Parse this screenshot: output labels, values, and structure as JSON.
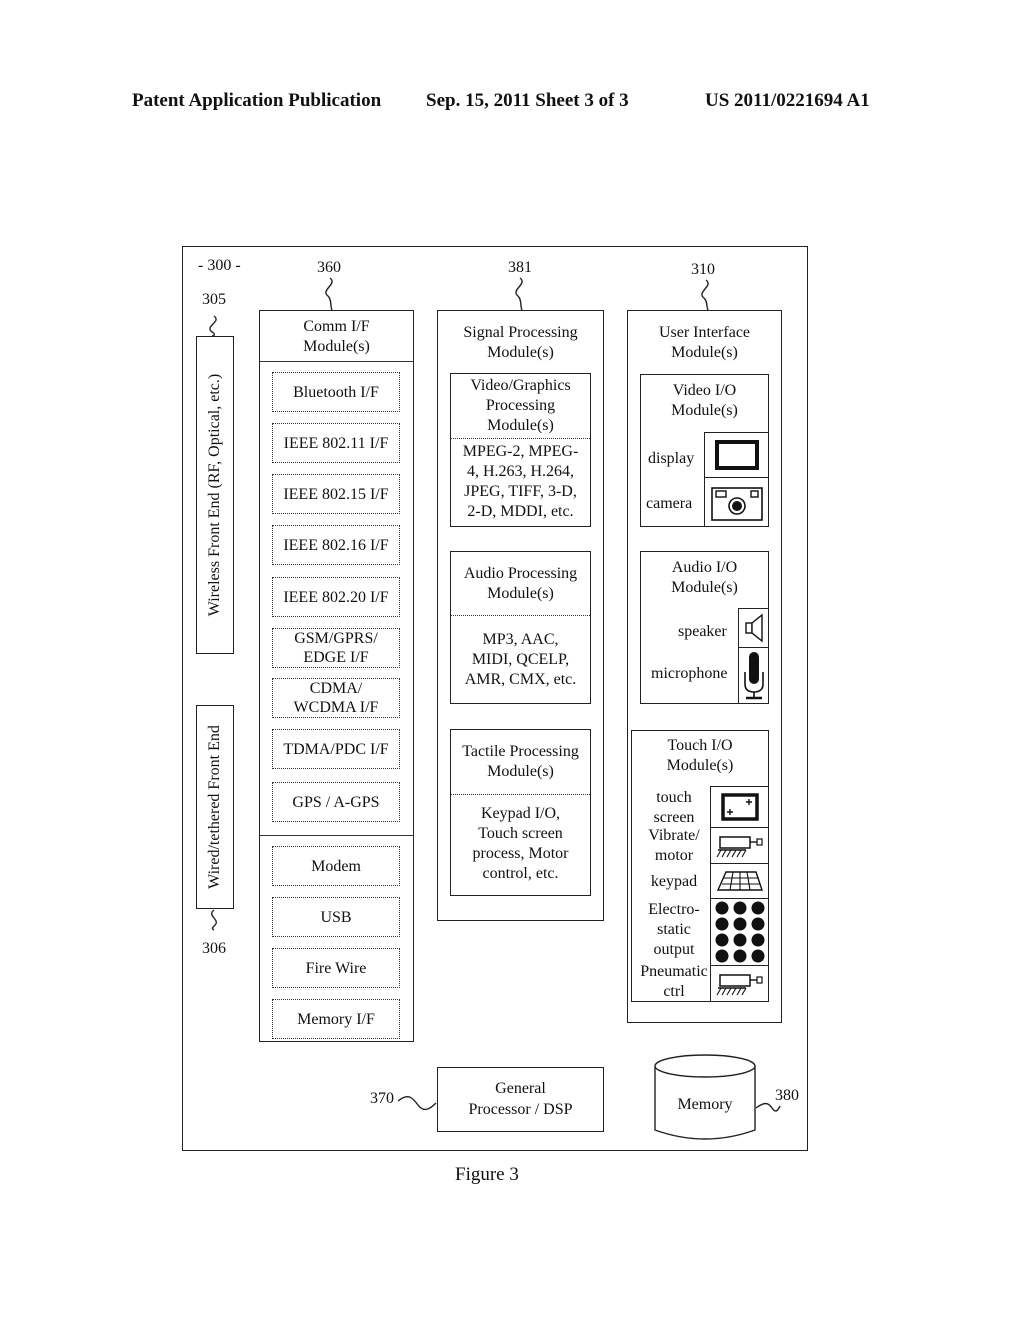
{
  "header": {
    "publication": "Patent Application Publication",
    "date_sheet": "Sep. 15, 2011   Sheet 3 of 3",
    "number": "US 2011/0221694 A1"
  },
  "figure": {
    "caption": "Figure 3",
    "system_ref": "- 300 -",
    "wireless_front_end": {
      "ref": "305",
      "label": "Wireless Front End (RF, Optical, etc.)"
    },
    "wired_front_end": {
      "ref": "306",
      "label": "Wired/tethered Front End"
    },
    "comm_module": {
      "ref": "360",
      "title": [
        "Comm I/F",
        "Module(s)"
      ],
      "wireless_items": [
        "Bluetooth I/F",
        "IEEE 802.11 I/F",
        "IEEE 802.15 I/F",
        "IEEE 802.16 I/F",
        "IEEE 802.20 I/F",
        "GSM/GPRS/ EDGE I/F",
        "CDMA/ WCDMA I/F",
        "TDMA/PDC I/F",
        "GPS / A-GPS"
      ],
      "wired_items": [
        "Modem",
        "USB",
        "Fire Wire",
        "Memory I/F"
      ]
    },
    "signal_module": {
      "ref": "381",
      "title": [
        "Signal Processing",
        "Module(s)"
      ],
      "video": {
        "title": [
          "Video/Graphics",
          "Processing",
          "Module(s)"
        ],
        "formats": [
          "MPEG-2, MPEG-",
          "4, H.263, H.264,",
          "JPEG, TIFF, 3-D,",
          "2-D, MDDI, etc."
        ]
      },
      "audio": {
        "title": [
          "Audio Processing",
          "Module(s)"
        ],
        "formats": [
          "MP3, AAC,",
          "MIDI, QCELP,",
          "AMR, CMX, etc."
        ]
      },
      "tactile": {
        "title": [
          "Tactile Processing",
          "Module(s)"
        ],
        "formats": [
          "Keypad I/O,",
          "Touch screen",
          "process, Motor",
          "control, etc."
        ]
      }
    },
    "ui_module": {
      "ref": "310",
      "title": [
        "User Interface",
        "Module(s)"
      ],
      "video_io": {
        "title": [
          "Video I/O",
          "Module(s)"
        ],
        "items": [
          {
            "label": "display",
            "icon": "display-icon"
          },
          {
            "label": "camera",
            "icon": "camera-icon"
          }
        ]
      },
      "audio_io": {
        "title": [
          "Audio I/O",
          "Module(s)"
        ],
        "items": [
          {
            "label": "speaker",
            "icon": "speaker-icon"
          },
          {
            "label": "microphone",
            "icon": "microphone-icon"
          }
        ]
      },
      "touch_io": {
        "title": [
          "Touch I/O",
          "Module(s)"
        ],
        "items": [
          {
            "label": "touch screen",
            "lines": [
              "touch",
              "screen"
            ],
            "icon": "touch-screen-icon"
          },
          {
            "label": "Vibrate/ motor",
            "lines": [
              "Vibrate/",
              "motor"
            ],
            "icon": "vibrate-motor-icon"
          },
          {
            "label": "keypad",
            "lines": [
              "keypad"
            ],
            "icon": "keypad-icon"
          },
          {
            "label": "Electro- static output",
            "lines": [
              "Electro-",
              "static",
              "output"
            ],
            "icon": "electrostatic-output-icon"
          },
          {
            "label": "Pneumatic ctrl",
            "lines": [
              "Pneumatic",
              "ctrl"
            ],
            "icon": "pneumatic-ctrl-icon"
          }
        ]
      }
    },
    "processor": {
      "ref": "370",
      "title": [
        "General",
        "Processor / DSP"
      ]
    },
    "memory": {
      "ref": "380",
      "title": "Memory"
    }
  }
}
